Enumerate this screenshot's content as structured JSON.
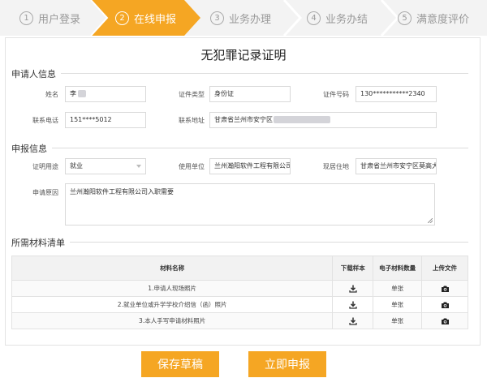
{
  "steps": [
    {
      "num": "1",
      "label": "用户登录",
      "active": false
    },
    {
      "num": "2",
      "label": "在线申报",
      "active": true
    },
    {
      "num": "3",
      "label": "业务办理",
      "active": false
    },
    {
      "num": "4",
      "label": "业务办结",
      "active": false
    },
    {
      "num": "5",
      "label": "满意度评价",
      "active": false
    }
  ],
  "colors": {
    "accent": "#f5a623",
    "step_bg": "#f3f3f3",
    "table_header_bg": "#f2f2f2"
  },
  "title": "无犯罪记录证明",
  "applicant": {
    "section_title": "申请人信息",
    "name_label": "姓名",
    "name_value": "李",
    "id_type_label": "证件类型",
    "id_type_value": "身份证",
    "id_number_label": "证件号码",
    "id_number_value": "130***********2340",
    "phone_label": "联系电话",
    "phone_value": "151****5012",
    "address_label": "联系地址",
    "address_value": "甘肃省兰州市安宁区"
  },
  "declaration": {
    "section_title": "申报信息",
    "purpose_label": "证明用途",
    "purpose_value": "就业",
    "employer_label": "使用单位",
    "employer_value": "兰州瀚阳软件工程有限公司",
    "residence_label": "现居住地",
    "residence_value": "甘肃省兰州市安宁区莫高大",
    "reason_label": "申请原因",
    "reason_value": "兰州瀚阳软件工程有限公司入职需要"
  },
  "materials": {
    "section_title": "所需材料清单",
    "headers": {
      "name": "材料名称",
      "download": "下载样本",
      "count": "电子材料数量",
      "upload": "上传文件"
    },
    "rows": [
      {
        "name": "1.申请人现场照片",
        "count": "单张",
        "download_icon": "download-icon",
        "upload_icon": "camera-icon"
      },
      {
        "name": "2.就业单位或升学学校介绍信（函）照片",
        "count": "单张",
        "download_icon": "download-icon",
        "upload_icon": "camera-icon"
      },
      {
        "name": "3.本人手写申请材料照片",
        "count": "单张",
        "download_icon": "download-icon",
        "upload_icon": "camera-icon"
      }
    ]
  },
  "buttons": {
    "save_draft": "保存草稿",
    "submit": "立即申报"
  }
}
